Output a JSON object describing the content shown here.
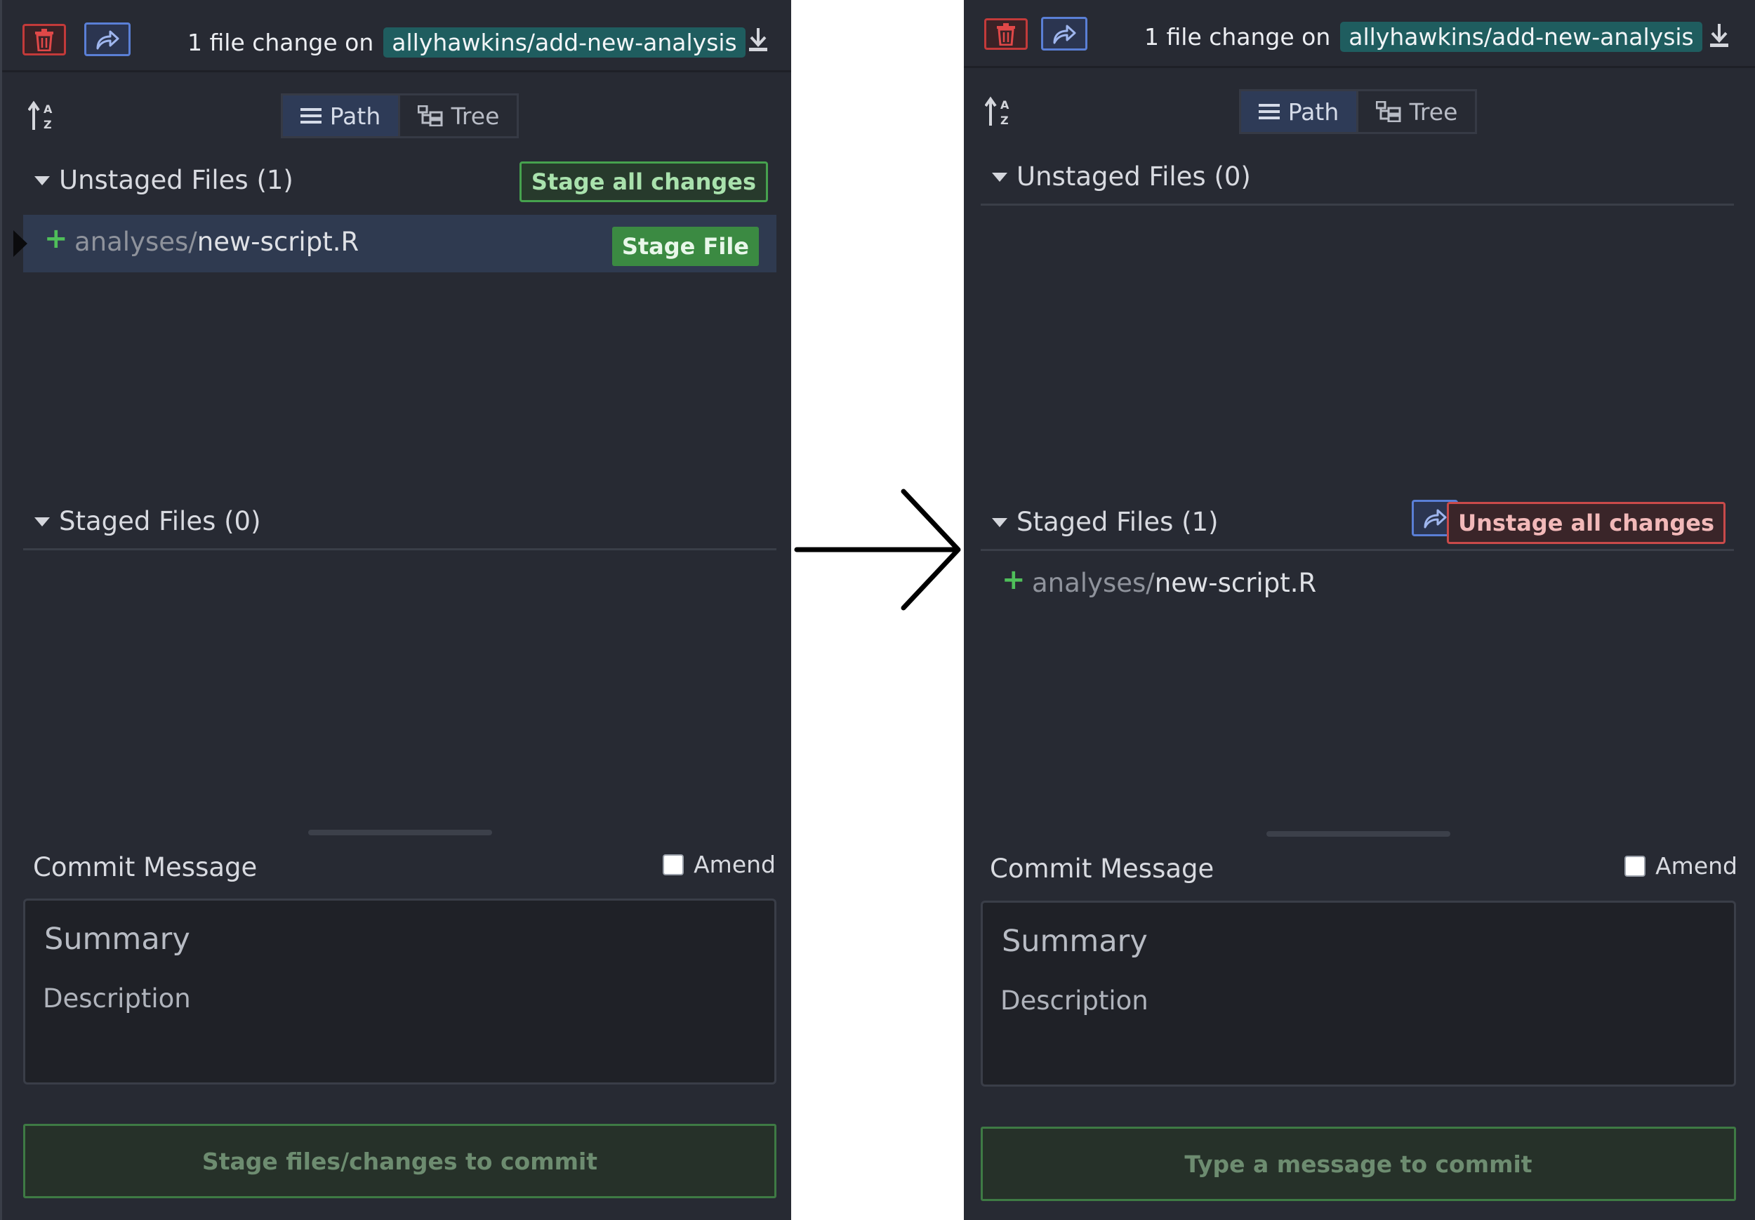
{
  "colors": {
    "panel_bg": "#272a33",
    "branch_bg": "#1f5d5f",
    "stage_green": "#3b8a42",
    "unstage_red": "#c94a4a",
    "stash_blue": "#5a7fd6",
    "added_plus": "#4fbf5a"
  },
  "icons": {
    "discard": "trash-icon",
    "stash": "share-arrow-icon",
    "download": "download-icon",
    "sort": "sort-az-icon",
    "path_view": "list-icon",
    "tree_view": "tree-icon",
    "transition": "right-arrow-icon"
  },
  "before": {
    "header": {
      "changes_text": "1 file change on",
      "branch": "allyhawkins/add-new-analysis"
    },
    "view_toggle": {
      "path_label": "Path",
      "tree_label": "Tree",
      "active": "Path"
    },
    "unstaged": {
      "title": "Unstaged Files (1)",
      "stage_all_label": "Stage all changes",
      "files": [
        {
          "status": "+",
          "dir": "analyses/",
          "name": "new-script.R",
          "action": "Stage File"
        }
      ]
    },
    "staged": {
      "title": "Staged Files (0)"
    },
    "commit": {
      "label": "Commit Message",
      "amend_label": "Amend",
      "amend_checked": false,
      "summary_placeholder": "Summary",
      "description_placeholder": "Description",
      "button_label": "Stage files/changes to commit"
    }
  },
  "after": {
    "header": {
      "changes_text": "1 file change on",
      "branch": "allyhawkins/add-new-analysis"
    },
    "view_toggle": {
      "path_label": "Path",
      "tree_label": "Tree",
      "active": "Path"
    },
    "unstaged": {
      "title": "Unstaged Files (0)"
    },
    "staged": {
      "title": "Staged Files (1)",
      "unstage_all_label": "Unstage all changes",
      "files": [
        {
          "status": "+",
          "dir": "analyses/",
          "name": "new-script.R"
        }
      ]
    },
    "commit": {
      "label": "Commit Message",
      "amend_label": "Amend",
      "amend_checked": false,
      "summary_placeholder": "Summary",
      "description_placeholder": "Description",
      "button_label": "Type a message to commit"
    }
  }
}
